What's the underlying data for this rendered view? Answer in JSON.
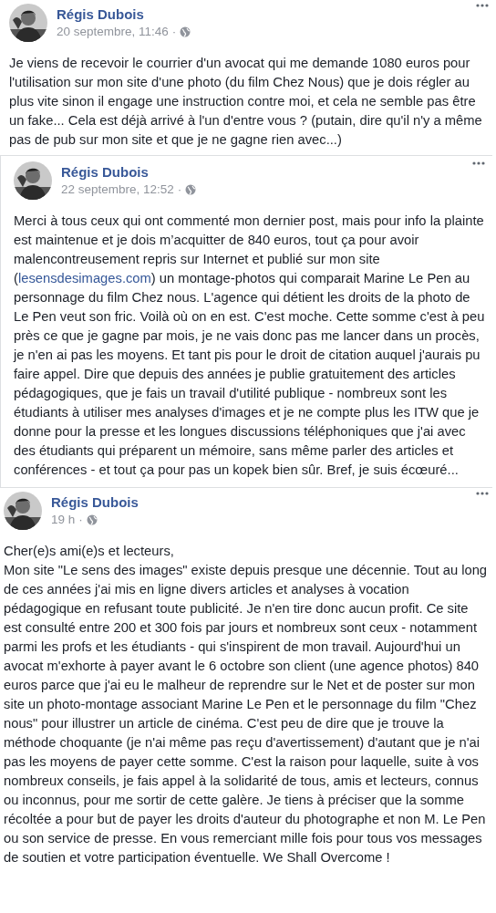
{
  "posts": [
    {
      "author": "Régis Dubois",
      "time": "20 septembre, 11:46",
      "separator": "·",
      "framed": false,
      "paragraphs": [
        [
          {
            "kind": "text",
            "text": "Je viens de recevoir le courrier d'un avocat qui me demande 1080 euros pour l'utilisation sur mon site d'une photo (du film Chez Nous) que je dois régler au plus vite sinon il engage une instruction contre moi, et cela ne semble pas être un fake... Cela est déjà arrivé à l'un d'entre vous ? (putain, dire qu'il n'y a même pas de pub sur mon site et que je ne gagne rien avec...)"
          }
        ]
      ]
    },
    {
      "author": "Régis Dubois",
      "time": "22 septembre, 12:52",
      "separator": "·",
      "framed": true,
      "paragraphs": [
        [
          {
            "kind": "text",
            "text": "Merci à tous ceux qui ont commenté mon dernier post, mais pour info la plainte est maintenue et je dois m’acquitter de 840 euros, tout ça pour avoir malencontreusement repris sur Internet et publié sur mon site ("
          },
          {
            "kind": "link",
            "text": "lesensdesimages.com"
          },
          {
            "kind": "text",
            "text": ") un montage-photos qui comparait Marine Le Pen au personnage du film Chez nous. L'agence qui détient les droits de la photo de Le Pen veut son fric. Voilà où on en est. C'est moche. Cette somme c'est à peu près ce que je gagne par mois, je ne vais donc pas me lancer dans un procès, je n'en ai pas les moyens. Et tant pis pour le droit de citation auquel j'aurais pu faire appel. Dire que depuis des années je publie gratuitement des articles pédagogiques, que je fais un travail d'utilité publique - nombreux sont les étudiants à utiliser mes analyses d'images et je ne compte plus les ITW que je donne pour la presse et les longues discussions téléphoniques que j'ai avec des étudiants qui préparent un mémoire, sans même parler des articles et conférences - et tout ça pour pas un kopek bien sûr. Bref, je suis écœuré..."
          }
        ]
      ]
    },
    {
      "author": "Régis Dubois",
      "time": "19 h",
      "separator": "·",
      "framed": false,
      "paragraphs": [
        [
          {
            "kind": "text",
            "text": "Cher(e)s ami(e)s et lecteurs,"
          }
        ],
        [
          {
            "kind": "text",
            "text": "Mon site \"Le sens des images\" existe depuis presque une décennie. Tout au long de ces années j'ai mis en ligne divers articles et analyses à vocation pédagogique en refusant toute publicité. Je n'en tire donc aucun profit. Ce site est consulté entre 200 et 300 fois par jours et nombreux sont ceux - notamment parmi les profs et les étudiants - qui s'inspirent de mon travail. Aujourd'hui un avocat m'exhorte à payer avant le 6 octobre son client (une agence photos) 840 euros parce que j'ai eu le malheur de reprendre sur le Net et de poster sur mon site un photo-montage associant Marine Le Pen et le personnage du film \"Chez nous\" pour illustrer un article de cinéma. C'est peu de dire que je trouve la méthode choquante (je n'ai même pas reçu d'avertissement) d'autant que je n'ai pas les moyens de payer cette somme. C'est la raison pour laquelle, suite à vos nombreux conseils, je fais appel à la solidarité de tous, amis et lecteurs, connus ou inconnus, pour me sortir de cette galère. Je tiens à préciser que la somme récoltée a pour but de payer les droits d'auteur du photographe et non M. Le Pen ou son service de presse. En vous remerciant mille fois pour tous vos messages de soutien et votre participation éventuelle. We Shall Overcome !"
          }
        ]
      ]
    }
  ]
}
